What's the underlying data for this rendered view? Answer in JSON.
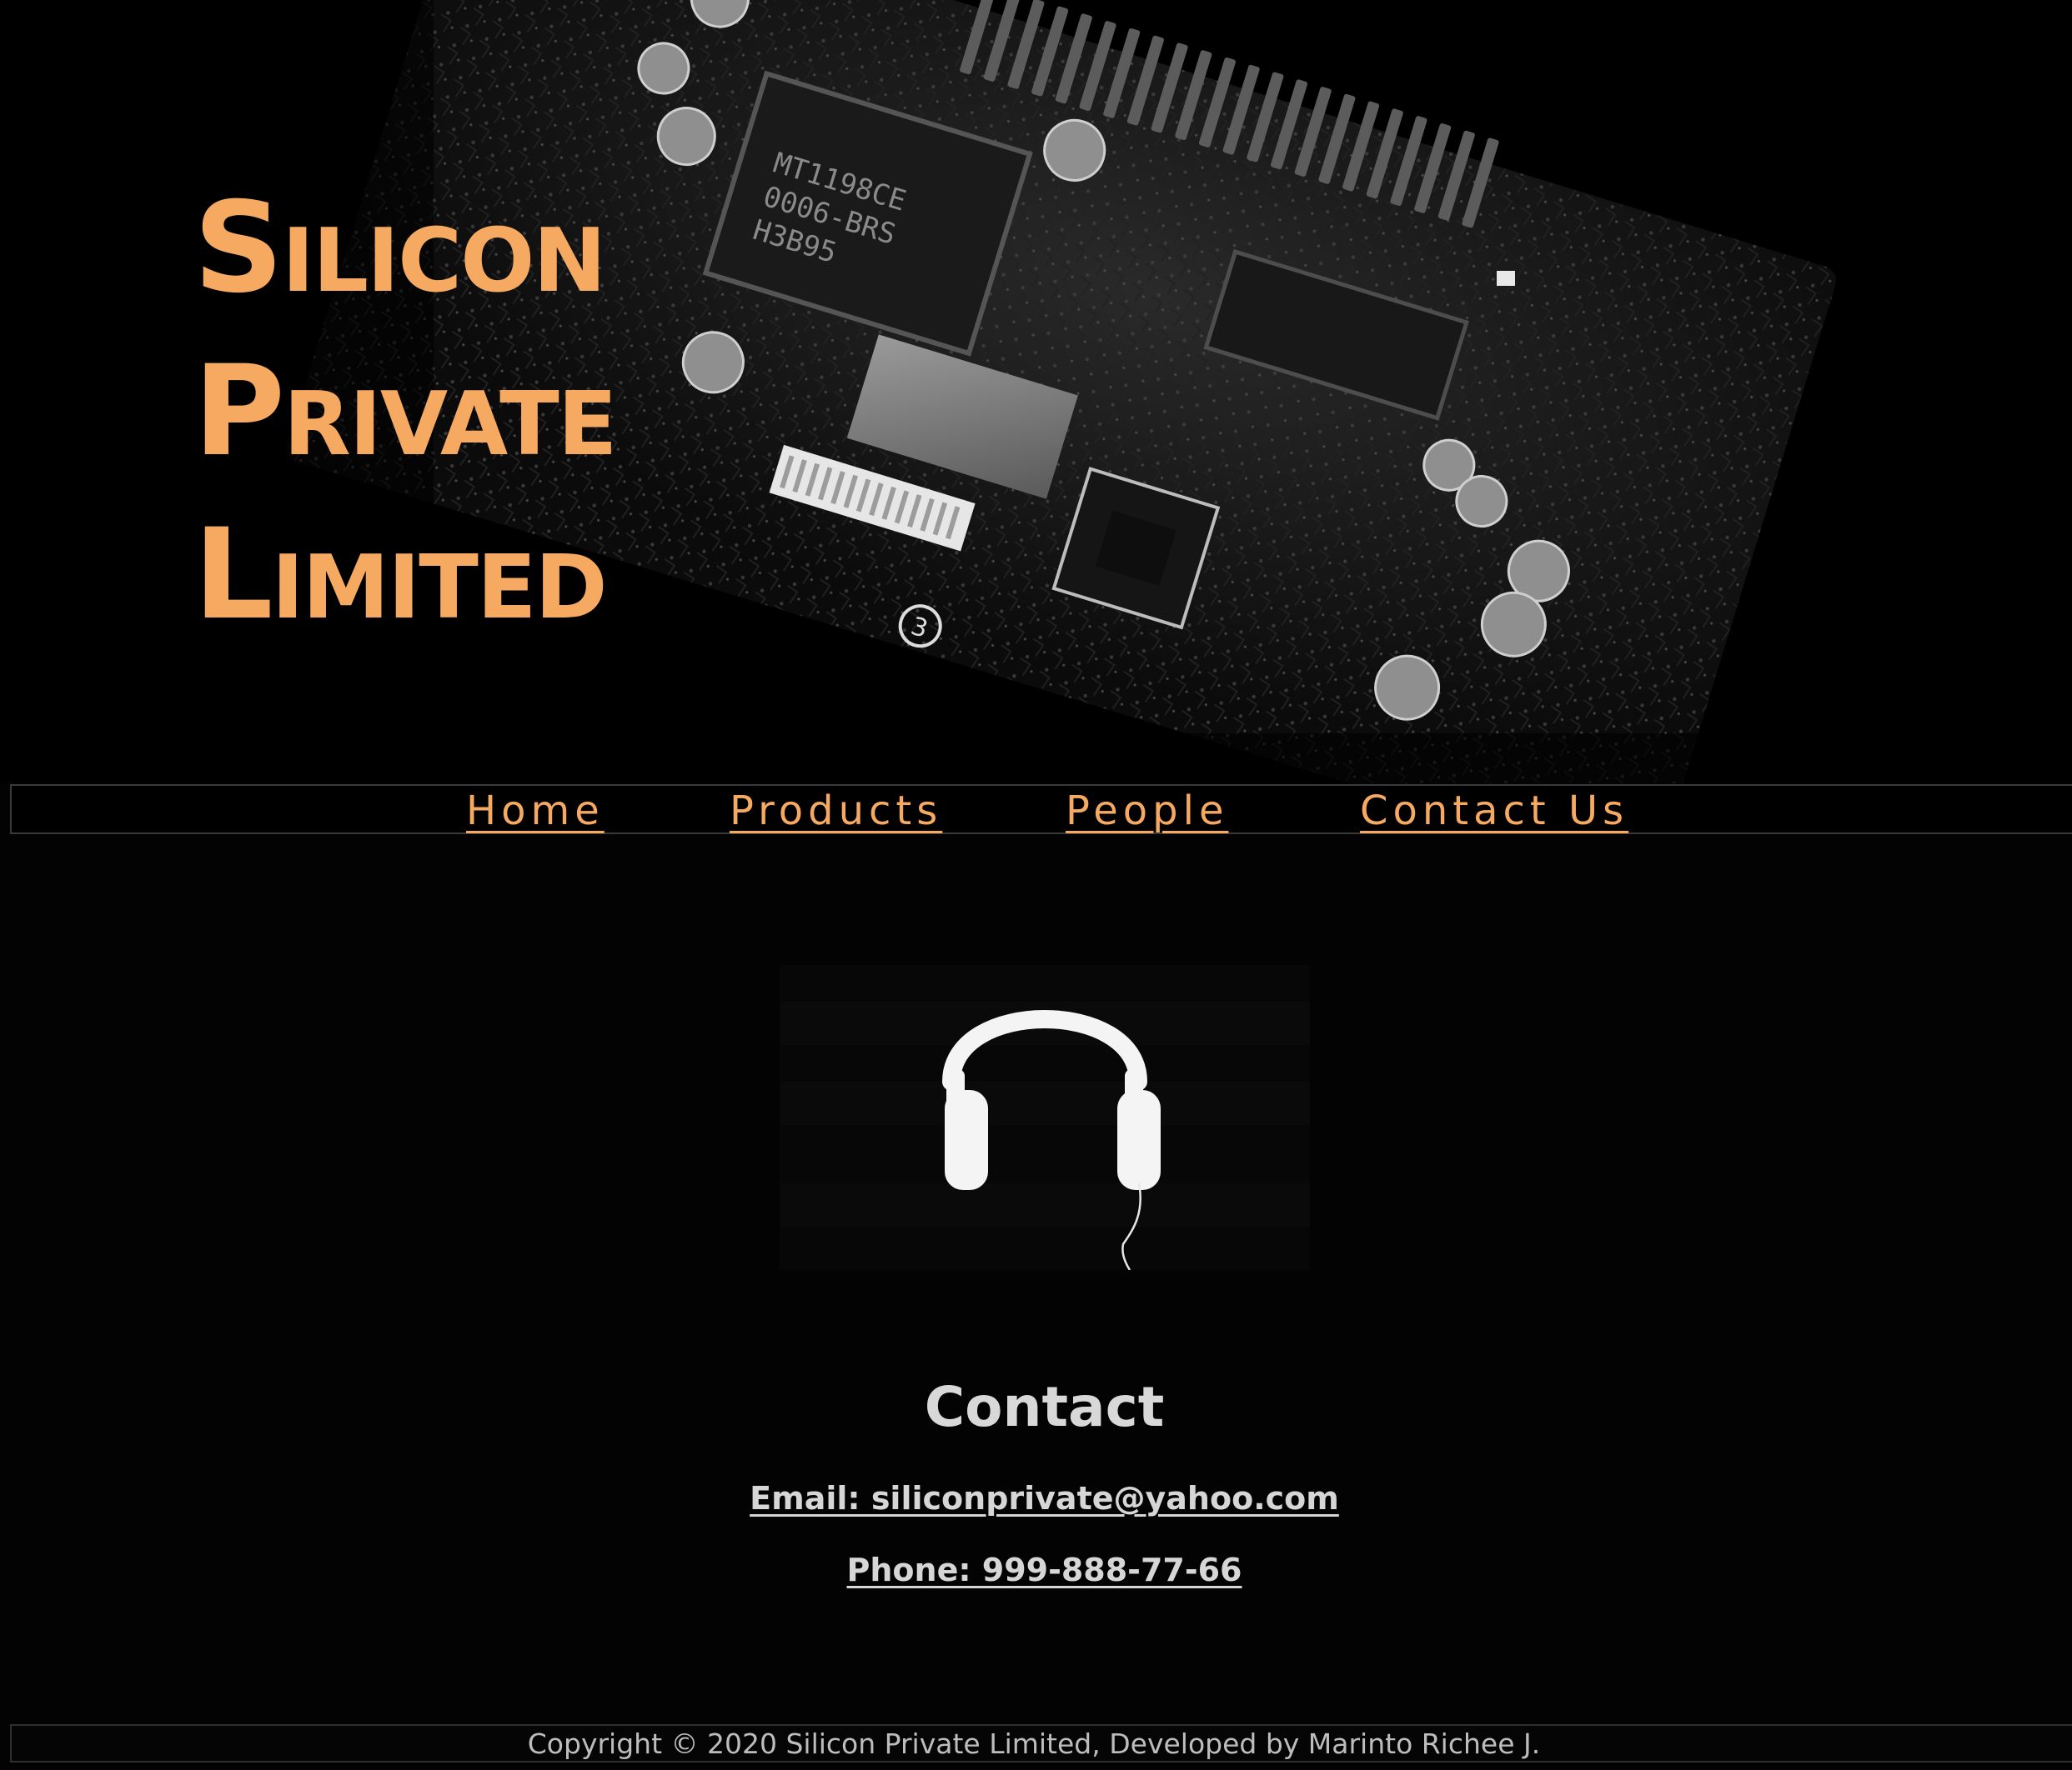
{
  "brand": {
    "title_lines": [
      "Silicon",
      "Private",
      "Limited"
    ],
    "accent_color": "#f6a961",
    "hero_image": "circuit-board-photo"
  },
  "nav": {
    "items": [
      {
        "label": "Home"
      },
      {
        "label": "Products"
      },
      {
        "label": "People"
      },
      {
        "label": "Contact Us"
      }
    ]
  },
  "main": {
    "image": "headphones-icon",
    "heading": "Contact",
    "email": "Email: siliconprivate@yahoo.com",
    "phone": "Phone: 999-888-77-66"
  },
  "footer": {
    "text": "Copyright © 2020 Silicon Private Limited, Developed by Marinto Richee J."
  }
}
